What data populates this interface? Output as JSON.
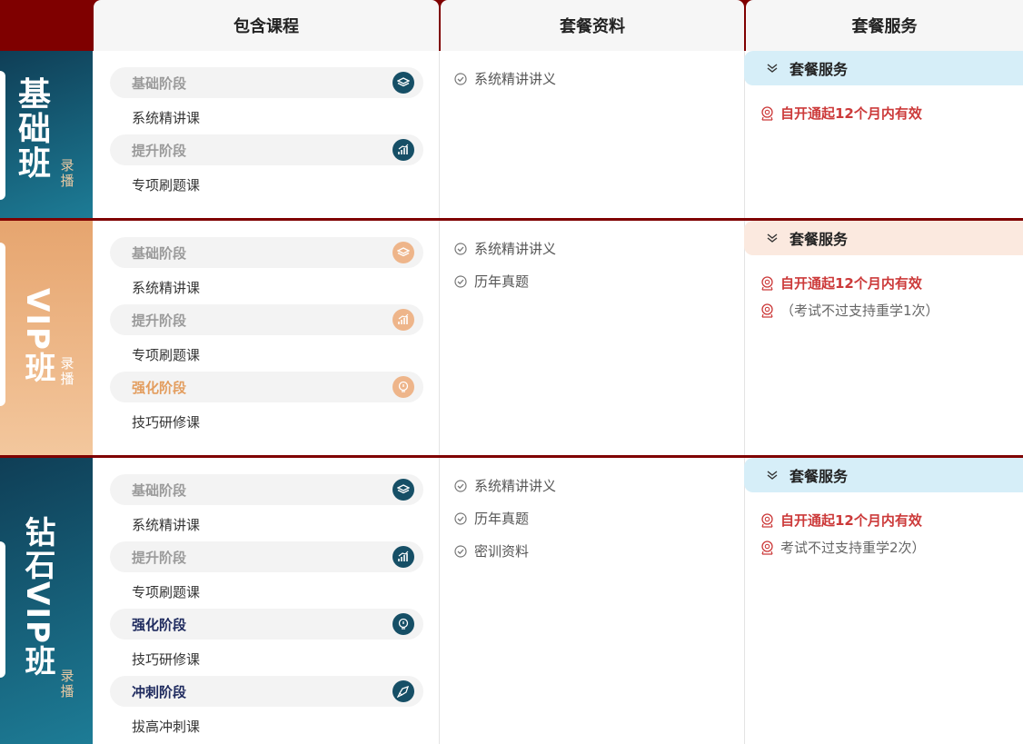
{
  "header": {
    "courses": "包含课程",
    "materials": "套餐资料",
    "services": "套餐服务"
  },
  "colors": {
    "header_bg": "#7f0000",
    "teal": "#164f66",
    "peach": "#eeb58a",
    "highlight_red": "#cc3a3a"
  },
  "packages": [
    {
      "name": "基础班",
      "tag": "录播",
      "stages": [
        {
          "name": "基础阶段",
          "course": "系统精讲课",
          "icon": "layers-icon"
        },
        {
          "name": "提升阶段",
          "course": "专项刷题课",
          "icon": "chart-icon"
        }
      ],
      "materials": [
        "系统精讲讲义"
      ],
      "service_title": "套餐服务",
      "services": [
        "自开通起12个月内有效"
      ]
    },
    {
      "name": "VIP班",
      "tag": "录播",
      "stages": [
        {
          "name": "基础阶段",
          "course": "系统精讲课",
          "icon": "layers-icon"
        },
        {
          "name": "提升阶段",
          "course": "专项刷题课",
          "icon": "chart-icon"
        },
        {
          "name": "强化阶段",
          "course": "技巧研修课",
          "icon": "lightbulb-head-icon"
        }
      ],
      "materials": [
        "系统精讲讲义",
        "历年真题"
      ],
      "service_title": "套餐服务",
      "services": [
        "自开通起12个月内有效",
        "（考试不过支持重学1次）"
      ]
    },
    {
      "name": "钻石VIP班",
      "tag": "录播",
      "stages": [
        {
          "name": "基础阶段",
          "course": "系统精讲课",
          "icon": "layers-icon"
        },
        {
          "name": "提升阶段",
          "course": "专项刷题课",
          "icon": "chart-icon"
        },
        {
          "name": "强化阶段",
          "course": "技巧研修课",
          "icon": "lightbulb-head-icon"
        },
        {
          "name": "冲刺阶段",
          "course": "拔高冲刺课",
          "icon": "rocket-icon"
        }
      ],
      "materials": [
        "系统精讲讲义",
        "历年真题",
        "密训资料"
      ],
      "service_title": "套餐服务",
      "services": [
        "自开通起12个月内有效",
        "考试不过支持重学2次）"
      ]
    }
  ]
}
